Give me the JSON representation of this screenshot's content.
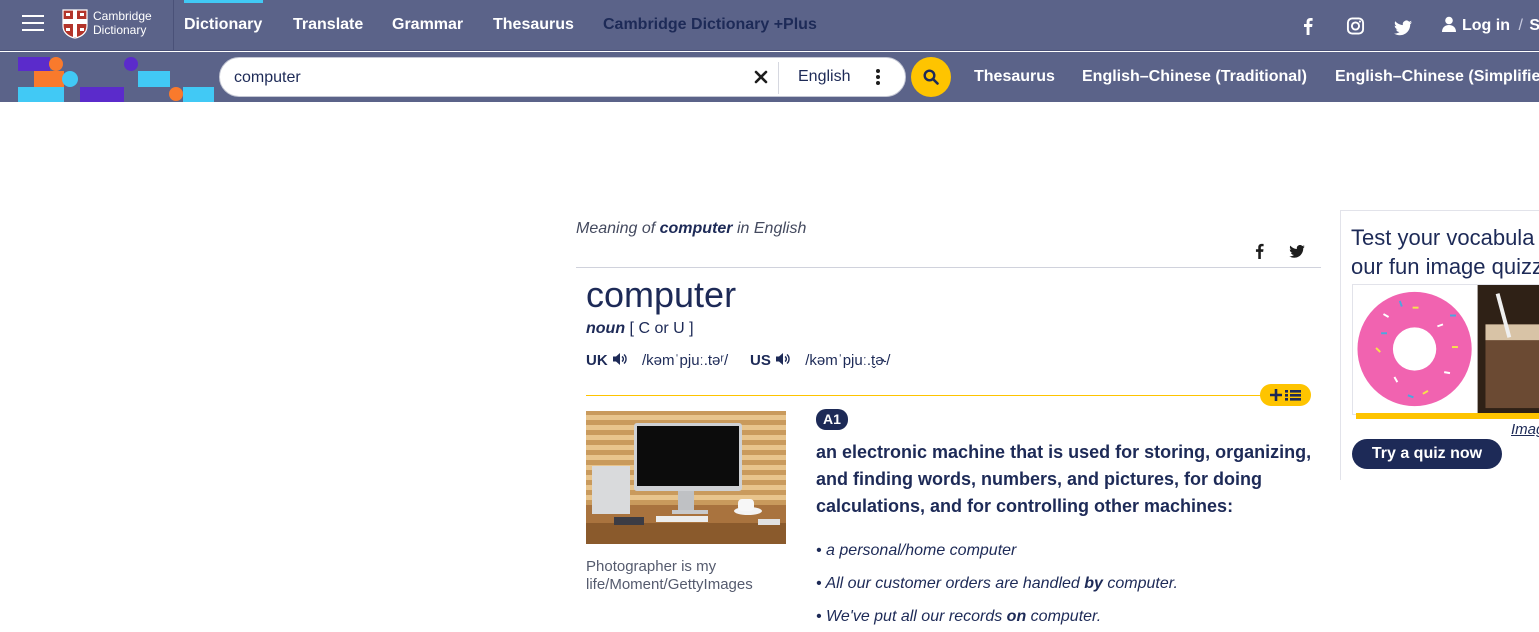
{
  "header": {
    "logo_line1": "Cambridge",
    "logo_line2": "Dictionary",
    "nav": [
      "Dictionary",
      "Translate",
      "Grammar",
      "Thesaurus",
      "Cambridge Dictionary +Plus"
    ],
    "login_label": "Log in",
    "login_sep": "/",
    "signup_fragment": "S"
  },
  "search": {
    "value": "computer",
    "language": "English",
    "sub_nav": [
      "Thesaurus",
      "English–Chinese (Traditional)",
      "English–Chinese (Simplifie"
    ]
  },
  "entry": {
    "meaning_prefix": "Meaning of",
    "meaning_word": "computer",
    "meaning_suffix": "in English",
    "headword": "computer",
    "pos": "noun",
    "grammar": "[ C or U ]",
    "uk_label": "UK",
    "uk_ipa": "/kəmˈpjuː.təʳ/",
    "us_label": "US",
    "us_ipa": "/kəmˈpjuː.t̬ɚ/",
    "photo_caption": "Photographer is my life/Moment/GettyImages",
    "level": "A1",
    "definition": "an electronic machine that is used for storing, organizing, and finding words, numbers, and pictures, for doing calculations, and for controlling other machines:",
    "examples": [
      {
        "before": "a personal/home computer",
        "bold": "",
        "after": ""
      },
      {
        "before": "All our customer orders are handled ",
        "bold": "by",
        "after": " computer."
      },
      {
        "before": "We've put all our records ",
        "bold": "on",
        "after": " computer."
      }
    ]
  },
  "quiz": {
    "title_line1": "Test your vocabula",
    "title_line2": "our fun image quizz",
    "credit": "Imag",
    "button": "Try a quiz now"
  },
  "colors": {
    "header_bg": "#5b6389",
    "navy": "#1d2a57",
    "accent_yellow": "#fec400",
    "accent_cyan": "#41c9f5"
  },
  "icons": [
    "menu-icon",
    "cambridge-shield-logo",
    "facebook-icon",
    "instagram-icon",
    "twitter-icon",
    "user-icon",
    "close-icon",
    "kebab-icon",
    "search-icon",
    "speaker-icon",
    "add-to-list-icon"
  ]
}
